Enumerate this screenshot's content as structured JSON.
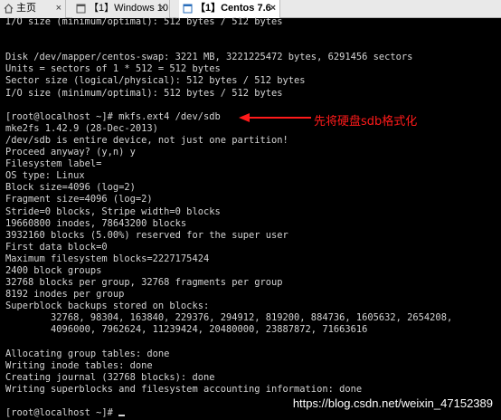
{
  "tabs": [
    {
      "label": "主页",
      "icon": "home-icon"
    },
    {
      "label": "【1】Windows 10",
      "icon": "vm-window-icon"
    },
    {
      "label": "【1】Centos 7.6",
      "icon": "vm-window-icon",
      "active": true
    }
  ],
  "terminal": {
    "lines": [
      "I/O size (minimum/optimal): 512 bytes / 512 bytes",
      "",
      "",
      "Disk /dev/mapper/centos-swap: 3221 MB, 3221225472 bytes, 6291456 sectors",
      "Units = sectors of 1 * 512 = 512 bytes",
      "Sector size (logical/physical): 512 bytes / 512 bytes",
      "I/O size (minimum/optimal): 512 bytes / 512 bytes",
      "",
      "[root@localhost ~]# mkfs.ext4 /dev/sdb",
      "mke2fs 1.42.9 (28-Dec-2013)",
      "/dev/sdb is entire device, not just one partition!",
      "Proceed anyway? (y,n) y",
      "Filesystem label=",
      "OS type: Linux",
      "Block size=4096 (log=2)",
      "Fragment size=4096 (log=2)",
      "Stride=0 blocks, Stripe width=0 blocks",
      "19660800 inodes, 78643200 blocks",
      "3932160 blocks (5.00%) reserved for the super user",
      "First data block=0",
      "Maximum filesystem blocks=2227175424",
      "2400 block groups",
      "32768 blocks per group, 32768 fragments per group",
      "8192 inodes per group",
      "Superblock backups stored on blocks:",
      "        32768, 98304, 163840, 229376, 294912, 819200, 884736, 1605632, 2654208,",
      "        4096000, 7962624, 11239424, 20480000, 23887872, 71663616",
      "",
      "Allocating group tables: done",
      "Writing inode tables: done",
      "Creating journal (32768 blocks): done",
      "Writing superblocks and filesystem accounting information: done",
      "",
      "[root@localhost ~]# "
    ]
  },
  "annotation": {
    "text": "先将硬盘sdb格式化",
    "color": "#ff1a1a"
  },
  "watermark": "https://blog.csdn.net/weixin_47152389"
}
